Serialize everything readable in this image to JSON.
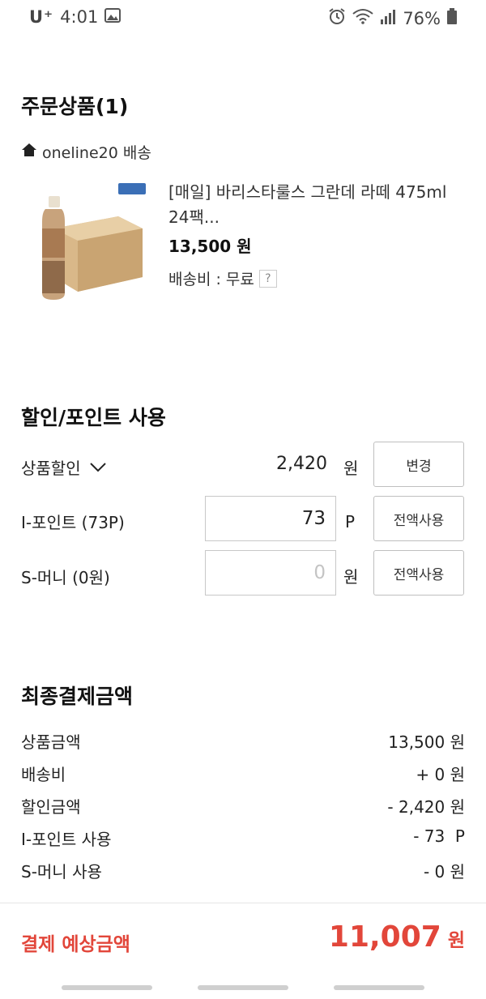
{
  "status_bar": {
    "carrier": "U⁺",
    "time": "4:01",
    "battery": "76%"
  },
  "order": {
    "title": "주문상품(1)",
    "shop": "oneline20 배송",
    "product": {
      "name": "[매일] 바리스타룰스 그란데 라떼 475ml 24팩...",
      "price": "13,500 원",
      "shipping": "배송비 : 무료",
      "help": "?"
    }
  },
  "discount": {
    "title": "할인/포인트 사용",
    "rows": [
      {
        "label": "상품할인",
        "amount": "2,420",
        "unit": "원",
        "button": "변경"
      },
      {
        "label": "I-포인트 (73P)",
        "value": "73",
        "unit": "P",
        "button": "전액사용"
      },
      {
        "label": "S-머니 (0원)",
        "placeholder": "0",
        "unit": "원",
        "button": "전액사용"
      }
    ]
  },
  "summary": {
    "title": "최종결제금액",
    "items": [
      {
        "label": "상품금액",
        "value": "13,500 원"
      },
      {
        "label": "배송비",
        "value": "+ 0 원"
      },
      {
        "label": "할인금액",
        "value": "- 2,420 원"
      },
      {
        "label": "I-포인트 사용",
        "value": "- 73  P"
      },
      {
        "label": "S-머니 사용",
        "value": "- 0 원"
      }
    ]
  },
  "total": {
    "label": "결제 예상금액",
    "amount": "11,007",
    "unit": "원"
  },
  "colors": {
    "accent": "#e2463a",
    "border": "#c8c8c8"
  }
}
